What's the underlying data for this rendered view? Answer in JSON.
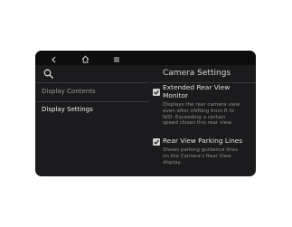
{
  "nav": {
    "back_icon": "back-arrow-icon",
    "home_icon": "home-icon",
    "menu_icon": "menu-icon"
  },
  "search_icon": "search-icon",
  "header": {
    "title": "Camera Settings"
  },
  "menu": {
    "items": [
      {
        "label": "Display Contents"
      },
      {
        "label": "Display Settings"
      }
    ]
  },
  "options": [
    {
      "checked": true,
      "title_lines": [
        "Extended Rear View",
        "Monitor"
      ],
      "desc_lines": [
        "Displays the rear camera view",
        "even after shifting from R to",
        "N/D. Exceeding a certain",
        "speed closes this rear view."
      ]
    },
    {
      "checked": true,
      "title_lines": [
        "Rear View Parking Lines"
      ],
      "desc_lines": [
        "Shows parking guidance lines",
        "on the Camera's Rear View",
        "display."
      ]
    }
  ],
  "colors": {
    "screen_bg": "#1b1b1d",
    "topbar_bg": "#0d0d0e",
    "text_light": "#e0e0e0",
    "text_muted": "#8e8e8e"
  }
}
